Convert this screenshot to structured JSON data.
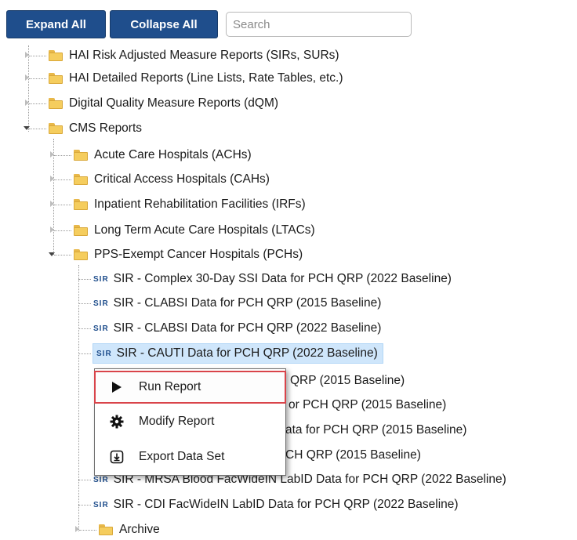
{
  "toolbar": {
    "expand_label": "Expand All",
    "collapse_label": "Collapse All",
    "search_placeholder": "Search"
  },
  "tree": {
    "root_folders": [
      "HAI Risk Adjusted Measure Reports (SIRs, SURs)",
      "HAI Detailed Reports (Line Lists, Rate Tables, etc.)",
      "Digital Quality Measure Reports (dQM)",
      "CMS Reports"
    ],
    "cms_folders": [
      "Acute Care Hospitals (ACHs)",
      "Critical Access Hospitals (CAHs)",
      "Inpatient Rehabilitation Facilities (IRFs)",
      "Long Term Acute Care Hospitals (LTACs)",
      "PPS-Exempt Cancer Hospitals (PCHs)"
    ],
    "pch_reports": [
      {
        "badge": "SIR",
        "label": "SIR - Complex 30-Day SSI Data for PCH QRP (2022 Baseline)"
      },
      {
        "badge": "SIR",
        "label": "SIR - CLABSI Data for PCH QRP (2015 Baseline)"
      },
      {
        "badge": "SIR",
        "label": "SIR - CLABSI Data for PCH QRP (2022 Baseline)"
      },
      {
        "badge": "SIR",
        "label": "SIR - CAUTI Data for PCH QRP (2022 Baseline)"
      },
      {
        "badge": "",
        "label": "QRP (2015 Baseline)"
      },
      {
        "badge": "",
        "label": "or PCH QRP (2015 Baseline)"
      },
      {
        "badge": "",
        "label": "ata for PCH QRP (2015 Baseline)"
      },
      {
        "badge": "",
        "label": "CH QRP (2015 Baseline)"
      },
      {
        "badge": "SIR",
        "label": "SIR - MRSA Blood FacWideIN LabID Data for PCH QRP (2022 Baseline)"
      },
      {
        "badge": "SIR",
        "label": "SIR - CDI FacWideIN LabID Data for PCH QRP (2022 Baseline)"
      }
    ],
    "archive_label": "Archive"
  },
  "context_menu": {
    "items": [
      {
        "label": "Run Report",
        "icon": "play-icon"
      },
      {
        "label": "Modify Report",
        "icon": "gear-icon"
      },
      {
        "label": "Export Data Set",
        "icon": "download-icon"
      }
    ]
  },
  "colors": {
    "button_blue": "#1f4e8c",
    "selection": "#cfe6fb",
    "highlight_outline": "#d9444a",
    "folder": "#f5cd5e"
  }
}
